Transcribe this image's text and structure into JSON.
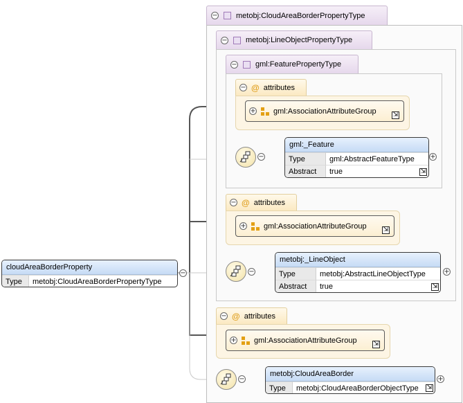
{
  "root": {
    "name": "cloudAreaBorderProperty",
    "type_key": "Type",
    "type_value": "metobj:CloudAreaBorderPropertyType"
  },
  "complex_types": [
    {
      "label": "metobj:CloudAreaBorderPropertyType"
    },
    {
      "label": "metobj:LineObjectPropertyType"
    },
    {
      "label": "gml:FeaturePropertyType"
    }
  ],
  "attributes_label": "attributes",
  "attribute_group_label": "gml:AssociationAttributeGroup",
  "elements": {
    "feature": {
      "name": "gml:_Feature",
      "type_key": "Type",
      "type_value": "gml:AbstractFeatureType",
      "abstract_key": "Abstract",
      "abstract_value": "true"
    },
    "line_object": {
      "name": "metobj:_LineObject",
      "type_key": "Type",
      "type_value": "metobj:AbstractLineObjectType",
      "abstract_key": "Abstract",
      "abstract_value": "true"
    },
    "cloud_area_border": {
      "name": "metobj:CloudAreaBorder",
      "type_key": "Type",
      "type_value": "metobj:CloudAreaBorderObjectType"
    }
  },
  "glyphs": {
    "collapse": "−",
    "expand": "+",
    "link": "⇲",
    "at": "@"
  },
  "icons": [
    "collapse-icon",
    "expand-icon",
    "complex-type-icon",
    "attribute-icon",
    "attribute-group-icon",
    "sequence-icon",
    "link-arrow-icon"
  ],
  "colors": {
    "element_header": "#c6dbf5",
    "complex_type_tab": "#e6d8ec",
    "attribute_tab": "#fbe9c2",
    "connector": "#555555"
  }
}
